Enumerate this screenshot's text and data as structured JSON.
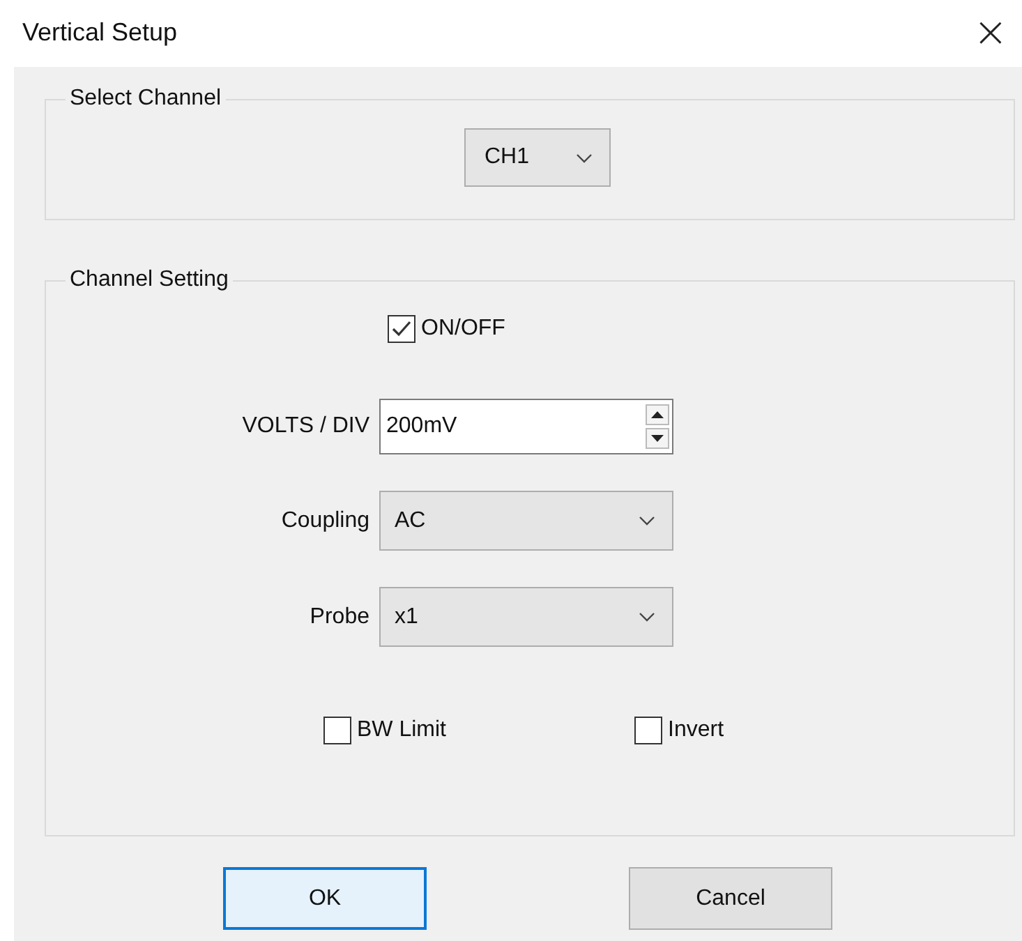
{
  "window": {
    "title": "Vertical Setup",
    "close": "×"
  },
  "select_channel": {
    "legend": "Select Channel",
    "value": "CH1"
  },
  "channel_setting": {
    "legend": "Channel Setting",
    "enable": {
      "label": "ON/OFF",
      "checked": true
    },
    "fields": [
      {
        "kind": "spinner",
        "label": "VOLTS / DIV",
        "value": "200mV"
      },
      {
        "kind": "dropdown",
        "label": "Coupling",
        "value": "AC"
      },
      {
        "kind": "dropdown",
        "label": "Probe",
        "value": "x1"
      }
    ],
    "options": [
      {
        "label": "BW Limit",
        "checked": false
      },
      {
        "label": "Invert",
        "checked": false
      }
    ]
  },
  "buttons": [
    {
      "label": "OK",
      "focused": true
    },
    {
      "label": "Cancel",
      "focused": false
    }
  ]
}
